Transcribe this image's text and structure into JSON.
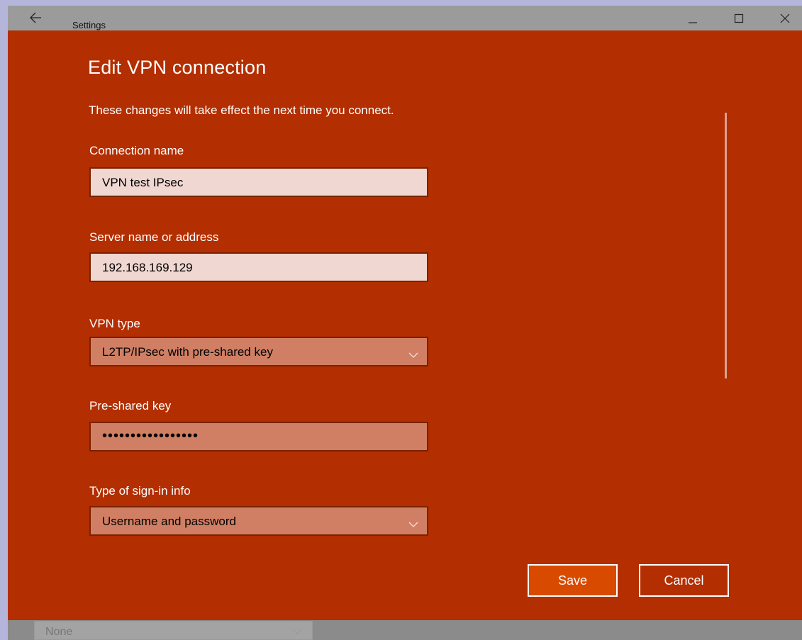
{
  "window": {
    "title": "Settings"
  },
  "dialog": {
    "heading": "Edit VPN connection",
    "subtitle": "These changes will take effect the next time you connect.",
    "connection_name": {
      "label": "Connection name",
      "value": "VPN test IPsec"
    },
    "server": {
      "label": "Server name or address",
      "value": "192.168.169.129"
    },
    "vpn_type": {
      "label": "VPN type",
      "value": "L2TP/IPsec with pre-shared key"
    },
    "psk": {
      "label": "Pre-shared key",
      "value": "•••••••••••••••••"
    },
    "signin": {
      "label": "Type of sign-in info",
      "value": "Username and password"
    },
    "save_label": "Save",
    "cancel_label": "Cancel"
  },
  "background": {
    "dropdown_value": "None"
  },
  "colors": {
    "dialog_bg": "#b32e00",
    "save_bg": "#d84a00",
    "field_light": "#f1d7d1",
    "field_dark": "#d07f64"
  },
  "icons": [
    "back-arrow-icon",
    "minimize-icon",
    "maximize-icon",
    "close-icon",
    "chevron-down-icon"
  ]
}
